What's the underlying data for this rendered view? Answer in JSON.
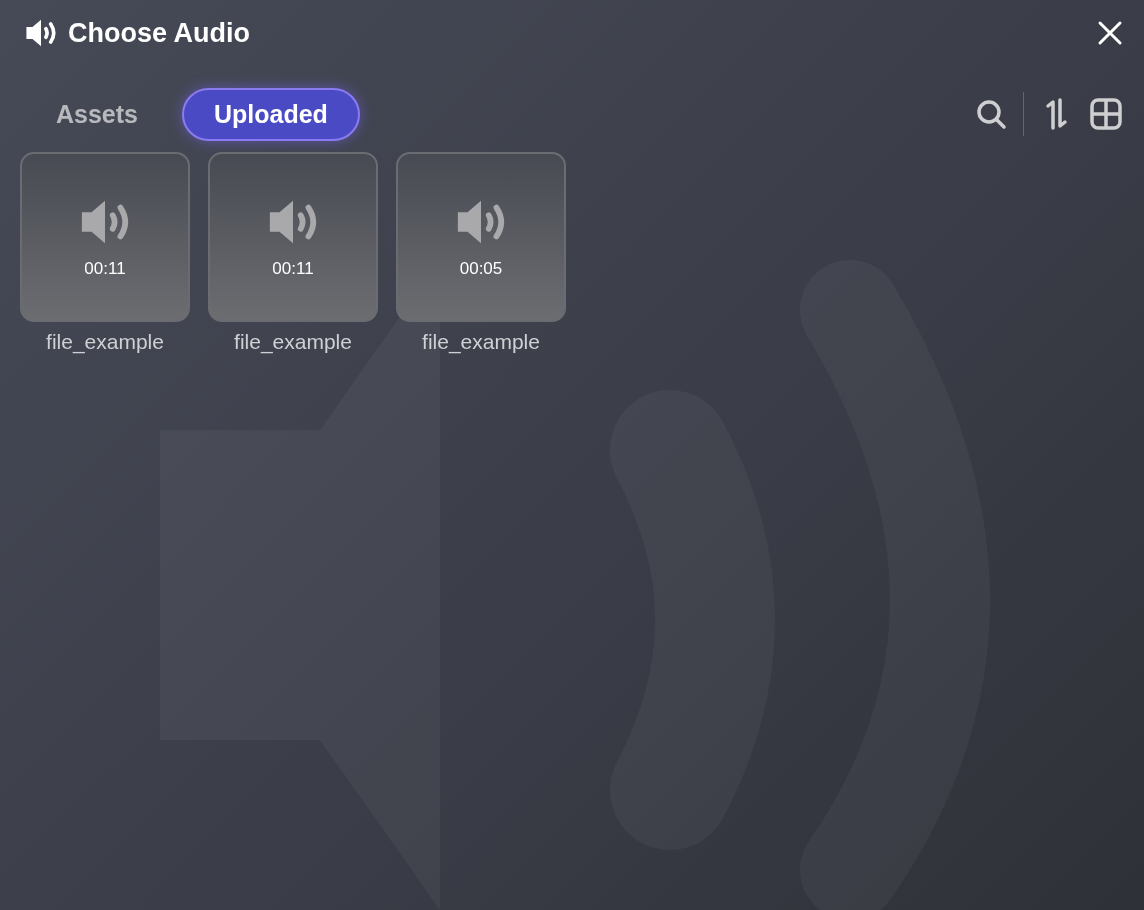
{
  "window": {
    "title": "Choose Audio"
  },
  "tabs": [
    {
      "label": "Assets",
      "selected": false
    },
    {
      "label": "Uploaded",
      "selected": true
    }
  ],
  "files": [
    {
      "duration": "00:11",
      "name": "file_example"
    },
    {
      "duration": "00:11",
      "name": "file_example"
    },
    {
      "duration": "00:05",
      "name": "file_example"
    }
  ]
}
